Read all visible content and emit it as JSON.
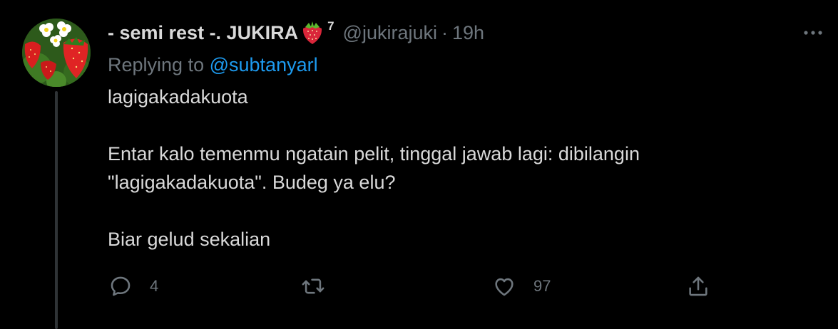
{
  "tweet": {
    "display_name": "- semi rest -. JUKIRA",
    "name_emoji": "strawberry",
    "superscript": "7",
    "handle": "@jukirajuki",
    "separator": "·",
    "time": "19h",
    "replying_prefix": "Replying to",
    "replying_handle": "@subtanyarl",
    "lines": [
      "lagigakadakuota",
      "Entar kalo temenmu ngatain pelit, tinggal jawab lagi: dibilangin",
      "\"lagigakadakuota\". Budeg ya elu?",
      "Biar gelud sekalian"
    ],
    "actions": {
      "reply_count": "4",
      "like_count": "97"
    }
  },
  "colors": {
    "background": "#000000",
    "text": "#d9d9d9",
    "secondary": "#6e767d",
    "link": "#1d9bf0",
    "thread_line": "#2f3336"
  },
  "icons": [
    "more-icon",
    "reply-icon",
    "retweet-icon",
    "like-icon",
    "share-icon",
    "strawberry-emoji"
  ]
}
